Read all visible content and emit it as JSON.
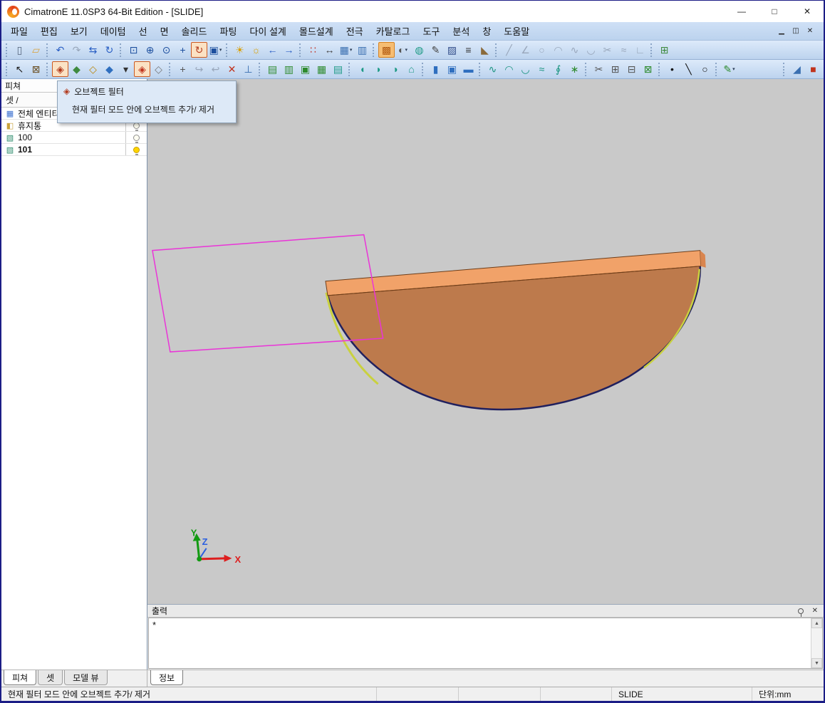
{
  "titlebar": {
    "title": "CimatronE 11.0SP3 64-Bit Edition - [SLIDE]",
    "controls": [
      {
        "n": "minimize-button",
        "g": "—"
      },
      {
        "n": "maximize-button",
        "g": "□"
      },
      {
        "n": "close-button",
        "g": "✕"
      }
    ]
  },
  "menu": {
    "items": [
      {
        "n": "menu-file",
        "label": "파일"
      },
      {
        "n": "menu-edit",
        "label": "편집"
      },
      {
        "n": "menu-view",
        "label": "보기"
      },
      {
        "n": "menu-datum",
        "label": "데이텀"
      },
      {
        "n": "menu-curve",
        "label": "선"
      },
      {
        "n": "menu-face",
        "label": "면"
      },
      {
        "n": "menu-solid",
        "label": "솔리드"
      },
      {
        "n": "menu-parting",
        "label": "파팅"
      },
      {
        "n": "menu-die-design",
        "label": "다이 설계"
      },
      {
        "n": "menu-mold-design",
        "label": "몰드설계"
      },
      {
        "n": "menu-electrode",
        "label": "전극"
      },
      {
        "n": "menu-catalog",
        "label": "카탈로그"
      },
      {
        "n": "menu-tools",
        "label": "도구"
      },
      {
        "n": "menu-analysis",
        "label": "분석"
      },
      {
        "n": "menu-window",
        "label": "창"
      },
      {
        "n": "menu-help",
        "label": "도움말"
      }
    ],
    "mdi_controls": [
      {
        "n": "mdi-minimize-button",
        "g": "▁"
      },
      {
        "n": "mdi-restore-button",
        "g": "◫"
      },
      {
        "n": "mdi-close-button",
        "g": "✕"
      }
    ]
  },
  "toolbars": {
    "row1": {
      "groups": [
        [
          {
            "n": "new-document-icon",
            "g": "▯",
            "c": "#53627a"
          },
          {
            "n": "open-file-icon",
            "g": "▱",
            "c": "#d9a13c"
          }
        ],
        [
          {
            "n": "undo-icon",
            "g": "↶",
            "c": "#2a5fc4"
          },
          {
            "n": "redo-icon",
            "g": "↷",
            "c": "#a3b1c4",
            "d": 1
          },
          {
            "n": "link-icon",
            "g": "⇆",
            "c": "#2a5fc4"
          },
          {
            "n": "refresh-icon",
            "g": "↻",
            "c": "#2a5fc4"
          }
        ],
        [
          {
            "n": "zoom-window-icon",
            "g": "⊡",
            "c": "#1d4f9e"
          },
          {
            "n": "zoom-in-out-icon",
            "g": "⊕",
            "c": "#1d4f9e"
          },
          {
            "n": "zoom-all-icon",
            "g": "⊙",
            "c": "#1d4f9e"
          },
          {
            "n": "pan-icon",
            "g": "+",
            "c": "#1d4f9e"
          },
          {
            "n": "rotate-view-icon",
            "g": "↻",
            "c": "#b33b1e",
            "sel": 1
          },
          {
            "n": "view-orientation-icon",
            "g": "▣",
            "c": "#1d4f9e",
            "v": 1
          }
        ],
        [
          {
            "n": "show-hide-icon",
            "g": "☀",
            "c": "#d99f00"
          },
          {
            "n": "show-all-icon",
            "g": "☼",
            "c": "#d99f00"
          },
          {
            "n": "previous-view-icon",
            "g": "←",
            "c": "#2a5fc4"
          },
          {
            "n": "next-view-icon",
            "g": "→",
            "c": "#2a5fc4"
          }
        ],
        [
          {
            "n": "snap-points-icon",
            "g": "∷",
            "c": "#c03a2e"
          },
          {
            "n": "measure-icon",
            "g": "↔",
            "c": "#444444"
          },
          {
            "n": "analysis-icon",
            "g": "▦",
            "c": "#3a6fb0",
            "v": 1
          },
          {
            "n": "entity-info-icon",
            "g": "▥",
            "c": "#3a6fb0"
          }
        ],
        [
          {
            "n": "shaded-display-icon",
            "g": "▩",
            "c": "#b35c12",
            "hl": 1
          },
          {
            "n": "render-mode-icon",
            "g": "◐",
            "c": "#555555",
            "v": 1
          },
          {
            "n": "color-fill-icon",
            "g": "◍",
            "c": "#1e9a86"
          },
          {
            "n": "attribute-pen-icon",
            "g": "✎",
            "c": "#444444"
          },
          {
            "n": "hatch-icon",
            "g": "▨",
            "c": "#35508c"
          },
          {
            "n": "display-list-icon",
            "g": "≡",
            "c": "#333333"
          },
          {
            "n": "erase-blank-icon",
            "g": "◣",
            "c": "#8a6a3a"
          }
        ],
        [
          {
            "n": "line-draft-icon",
            "g": "╱",
            "c": "#98a6ba",
            "d": 1
          },
          {
            "n": "angle-draft-icon",
            "g": "∠",
            "c": "#98a6ba",
            "d": 1
          },
          {
            "n": "circle-draft-icon",
            "g": "○",
            "c": "#98a6ba",
            "d": 1
          },
          {
            "n": "arc-draft-icon",
            "g": "◠",
            "c": "#98a6ba",
            "d": 1
          },
          {
            "n": "spline-draft-icon",
            "g": "∿",
            "c": "#98a6ba",
            "d": 1
          },
          {
            "n": "fillet-draft-icon",
            "g": "◡",
            "c": "#98a6ba",
            "d": 1
          },
          {
            "n": "trim-draft-icon",
            "g": "✂",
            "c": "#98a6ba",
            "d": 1
          },
          {
            "n": "offset-draft-icon",
            "g": "≈",
            "c": "#98a6ba",
            "d": 1
          },
          {
            "n": "corner-draft-icon",
            "g": "∟",
            "c": "#98a6ba",
            "d": 1
          }
        ],
        [
          {
            "n": "grid-icon",
            "g": "⊞",
            "c": "#3f8a3f"
          }
        ]
      ]
    },
    "row2": {
      "groups": [
        [
          {
            "n": "pick-arrow-icon",
            "g": "↖",
            "c": "#222222"
          },
          {
            "n": "quick-select-icon",
            "g": "⊠",
            "c": "#6a4f23"
          }
        ],
        [
          {
            "n": "object-filter-icon",
            "g": "◈",
            "c": "#b23a1d",
            "sel": 1
          },
          {
            "n": "filter-faces-icon",
            "g": "◆",
            "c": "#3f8a3f"
          },
          {
            "n": "filter-curves-icon",
            "g": "◇",
            "c": "#b8860b"
          },
          {
            "n": "filter-solids-icon",
            "g": "◆",
            "c": "#2f6fbf"
          },
          {
            "n": "filter-options-caret",
            "g": "▾",
            "c": "#333333"
          },
          {
            "n": "filter-clear-icon",
            "g": "◈",
            "c": "#c0331d",
            "sel": 1
          },
          {
            "n": "filter-mode-icon",
            "g": "◇",
            "c": "#777777"
          }
        ],
        [
          {
            "n": "ucs-icon",
            "g": "+",
            "c": "#555555"
          },
          {
            "n": "relimit-icon",
            "g": "↪",
            "c": "#98a6ba"
          },
          {
            "n": "drag-icon",
            "g": "↩",
            "c": "#98a6ba"
          },
          {
            "n": "delete-icon",
            "g": "✕",
            "c": "#c0331d"
          },
          {
            "n": "axes-icon",
            "g": "⊥",
            "c": "#3a6fb0"
          }
        ],
        [
          {
            "n": "add-drawing-icon",
            "g": "▤",
            "c": "#2d8a2d"
          },
          {
            "n": "copy-drawing-icon",
            "g": "▥",
            "c": "#2d8a2d"
          },
          {
            "n": "catalog-doc-icon",
            "g": "▣",
            "c": "#2d8a2d"
          },
          {
            "n": "sheet-icon",
            "g": "▦",
            "c": "#2d8a2d"
          },
          {
            "n": "report-icon",
            "g": "▤",
            "c": "#1e9a86"
          }
        ],
        [
          {
            "n": "drive-surface-icon",
            "g": "◖",
            "c": "#1e9a86"
          },
          {
            "n": "blend-surface-icon",
            "g": "◗",
            "c": "#1e9a86"
          },
          {
            "n": "extend-surface-icon",
            "g": "◑",
            "c": "#1e9a86"
          },
          {
            "n": "patch-surface-icon",
            "g": "⌂",
            "c": "#1e9a86"
          }
        ],
        [
          {
            "n": "extrude-solid-icon",
            "g": "▮",
            "c": "#2f6fbf"
          },
          {
            "n": "revolve-solid-icon",
            "g": "▣",
            "c": "#2f6fbf"
          },
          {
            "n": "round-solid-icon",
            "g": "▬",
            "c": "#2f6fbf"
          }
        ],
        [
          {
            "n": "spline-curve-icon",
            "g": "∿",
            "c": "#18937e"
          },
          {
            "n": "arc-curve-icon",
            "g": "◠",
            "c": "#18937e"
          },
          {
            "n": "offset-curve-icon",
            "g": "◡",
            "c": "#18937e"
          },
          {
            "n": "project-curve-icon",
            "g": "≈",
            "c": "#18937e"
          },
          {
            "n": "composite-curve-icon",
            "g": "∮",
            "c": "#18937e"
          },
          {
            "n": "pattern-icon",
            "g": "∗",
            "c": "#2d8a2d"
          }
        ],
        [
          {
            "n": "split-icon",
            "g": "✂",
            "c": "#555555"
          },
          {
            "n": "mesh-icon",
            "g": "⊞",
            "c": "#555555"
          },
          {
            "n": "remesh-icon",
            "g": "⊟",
            "c": "#555555"
          },
          {
            "n": "stitch-icon",
            "g": "⊠",
            "c": "#2d8a2d"
          }
        ],
        [
          {
            "n": "point-tool-icon",
            "g": "•",
            "c": "#111111"
          },
          {
            "n": "line-tool-icon",
            "g": "╲",
            "c": "#111111"
          },
          {
            "n": "circle-tool-icon",
            "g": "○",
            "c": "#111111"
          }
        ],
        [
          {
            "n": "sketcher-icon",
            "g": "✎",
            "c": "#2d8a2d",
            "v": 1
          }
        ]
      ],
      "tail_groups": [
        [
          {
            "n": "wcs-triad-icon",
            "g": "◢",
            "c": "#3a6fb0"
          },
          {
            "n": "exit-app-icon",
            "g": "■",
            "c": "#c0331d"
          }
        ]
      ]
    }
  },
  "left_panel": {
    "title": "피쳐",
    "header_buttons": [
      {
        "n": "panel-menu-button",
        "g": "▾"
      },
      {
        "n": "panel-close-button",
        "g": "✕"
      }
    ],
    "subheader": "셋  /",
    "tree_icons": {
      "entities": {
        "g": "▦",
        "c": "#3a6fd0"
      },
      "trash": {
        "g": "◧",
        "c": "#c9a23c"
      },
      "set": {
        "g": "▧",
        "c": "#2a8a6a"
      }
    },
    "tree": [
      {
        "n": "tree-item-all-entities",
        "icon": "entities",
        "label": "전체 엔티티",
        "bulb": "off"
      },
      {
        "n": "tree-item-trash",
        "icon": "trash",
        "label": "휴지통",
        "bulb": "off"
      },
      {
        "n": "tree-item-set-100",
        "icon": "set",
        "label": "100",
        "bulb": "off"
      },
      {
        "n": "tree-item-set-101",
        "icon": "set",
        "label": "101",
        "bulb": "on",
        "bold": true
      }
    ]
  },
  "tooltip": {
    "icon_glyph": "◈",
    "title": "오브젝트 필터",
    "description": "현재 필터 모드 안에 오브젝트 추가/ 제거"
  },
  "viewport": {
    "axes": {
      "x": "X",
      "y": "Y",
      "z": "Z"
    }
  },
  "output": {
    "title": "출력",
    "content": "*",
    "scroll_up": "▲",
    "scroll_down": "▼"
  },
  "tabs": {
    "left": [
      {
        "n": "tab-features",
        "label": "피쳐",
        "active": true
      },
      {
        "n": "tab-sets",
        "label": "셋",
        "active": false
      },
      {
        "n": "tab-model-view",
        "label": "모델 뷰",
        "active": false
      }
    ],
    "right": [
      {
        "n": "tab-info",
        "label": "정보",
        "active": true
      }
    ]
  },
  "statusbar": {
    "message": "현재 필터 모드 안에 오브젝트 추가/ 제거",
    "doc": "SLIDE",
    "unit": "단위:mm"
  },
  "colors": {
    "viewport_bg": "#c9c9c9",
    "model_top": "#f1a269",
    "model_face": "#bd7a4c",
    "model_cap": "#d9854f",
    "model_outline": "#20205e",
    "edge_highlight": "#c9d13f",
    "rim_edge": "#6e3d18",
    "selection_rect": "#ea34d8",
    "axis_x": "#dd1f1f",
    "axis_y": "#129a12",
    "axis_z": "#2b5fe0",
    "accent_selected": "#cc5a21"
  }
}
